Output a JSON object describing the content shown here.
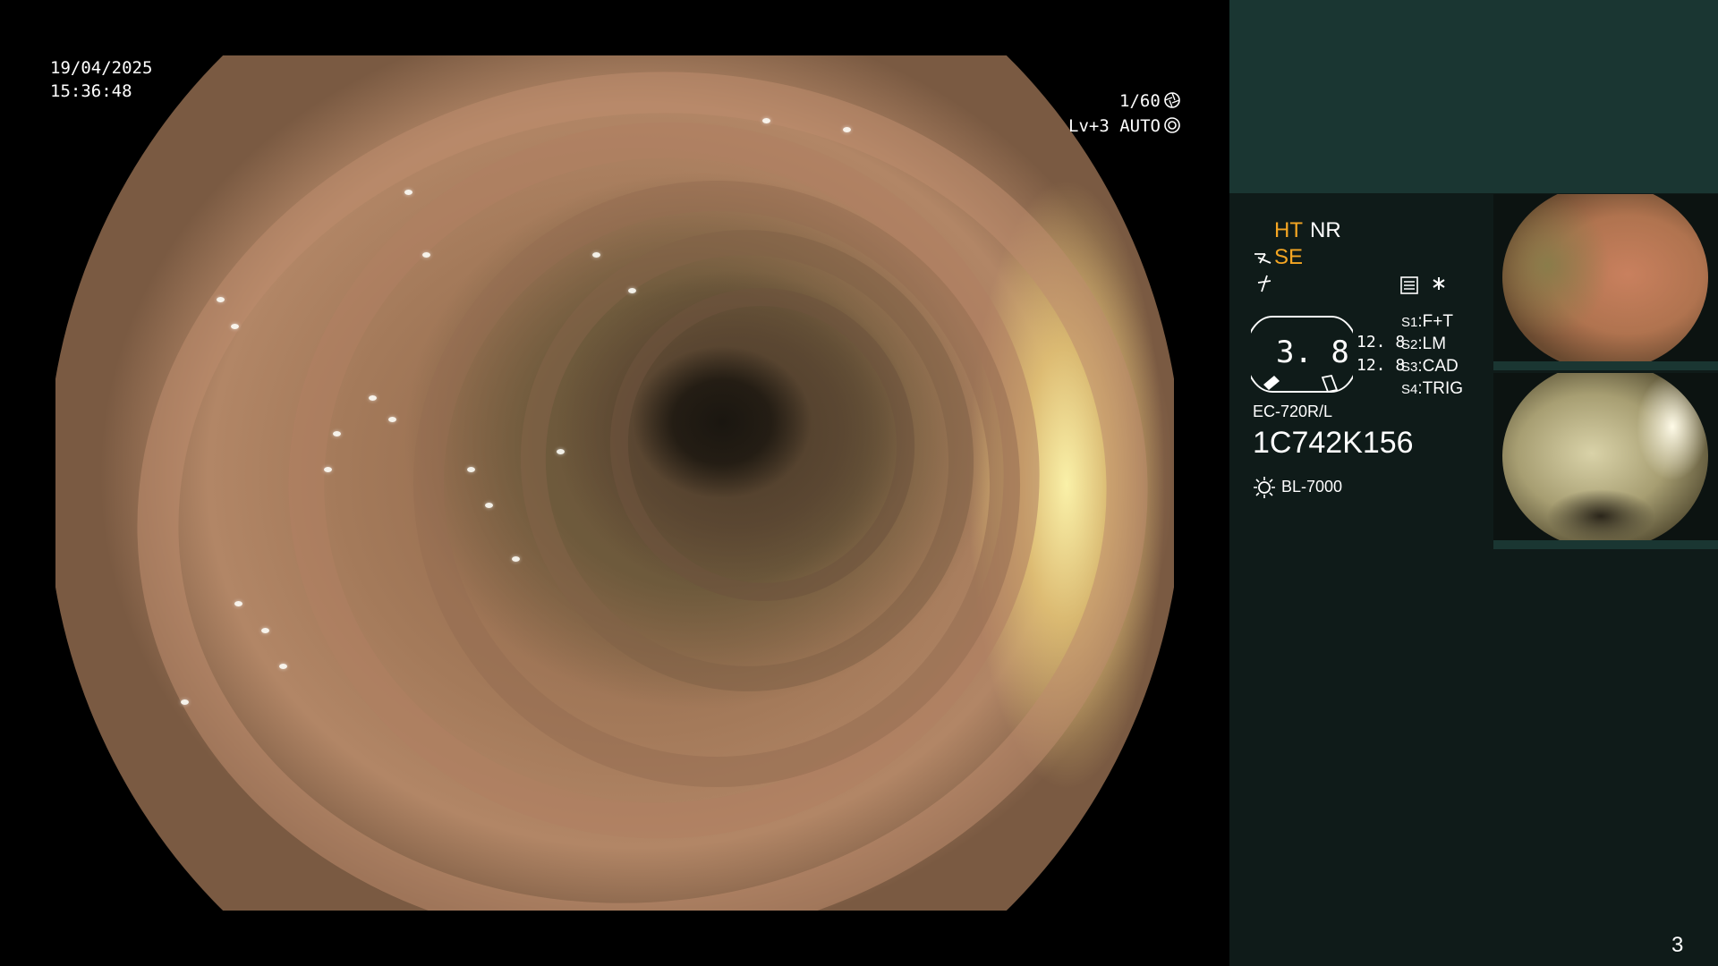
{
  "live_view": {
    "date": "19/04/2025",
    "time": "15:36:48",
    "shutter": "1/60",
    "iris": "Lv+3 AUTO"
  },
  "panel": {
    "ht_label": "HT",
    "nr_label": "NR",
    "se_label": "SE",
    "zoom_value": "3. 8",
    "magnification_top": "12. 8",
    "magnification_bottom": "12. 8",
    "scope_switches": [
      {
        "key": "S1",
        "value": "F+T"
      },
      {
        "key": "S2",
        "value": "LM"
      },
      {
        "key": "S3",
        "value": "CAD"
      },
      {
        "key": "S4",
        "value": "TRIG"
      }
    ],
    "scope_model": "EC-720R/L",
    "scope_serial": "1C742K156",
    "light_source": "BL-7000",
    "image_count": "3"
  },
  "colors": {
    "accent_orange": "#f5a623",
    "panel_bg": "#0f1b19",
    "panel_header": "#1a3632"
  },
  "icons": {
    "shutter": "shutter-aperture-icon",
    "iris": "iris-icon",
    "se_prefix": "se-mode-icon",
    "lightning": "lightning-icon",
    "menu": "menu-list-icon",
    "asterisk": "asterisk-icon",
    "light": "light-source-icon"
  }
}
